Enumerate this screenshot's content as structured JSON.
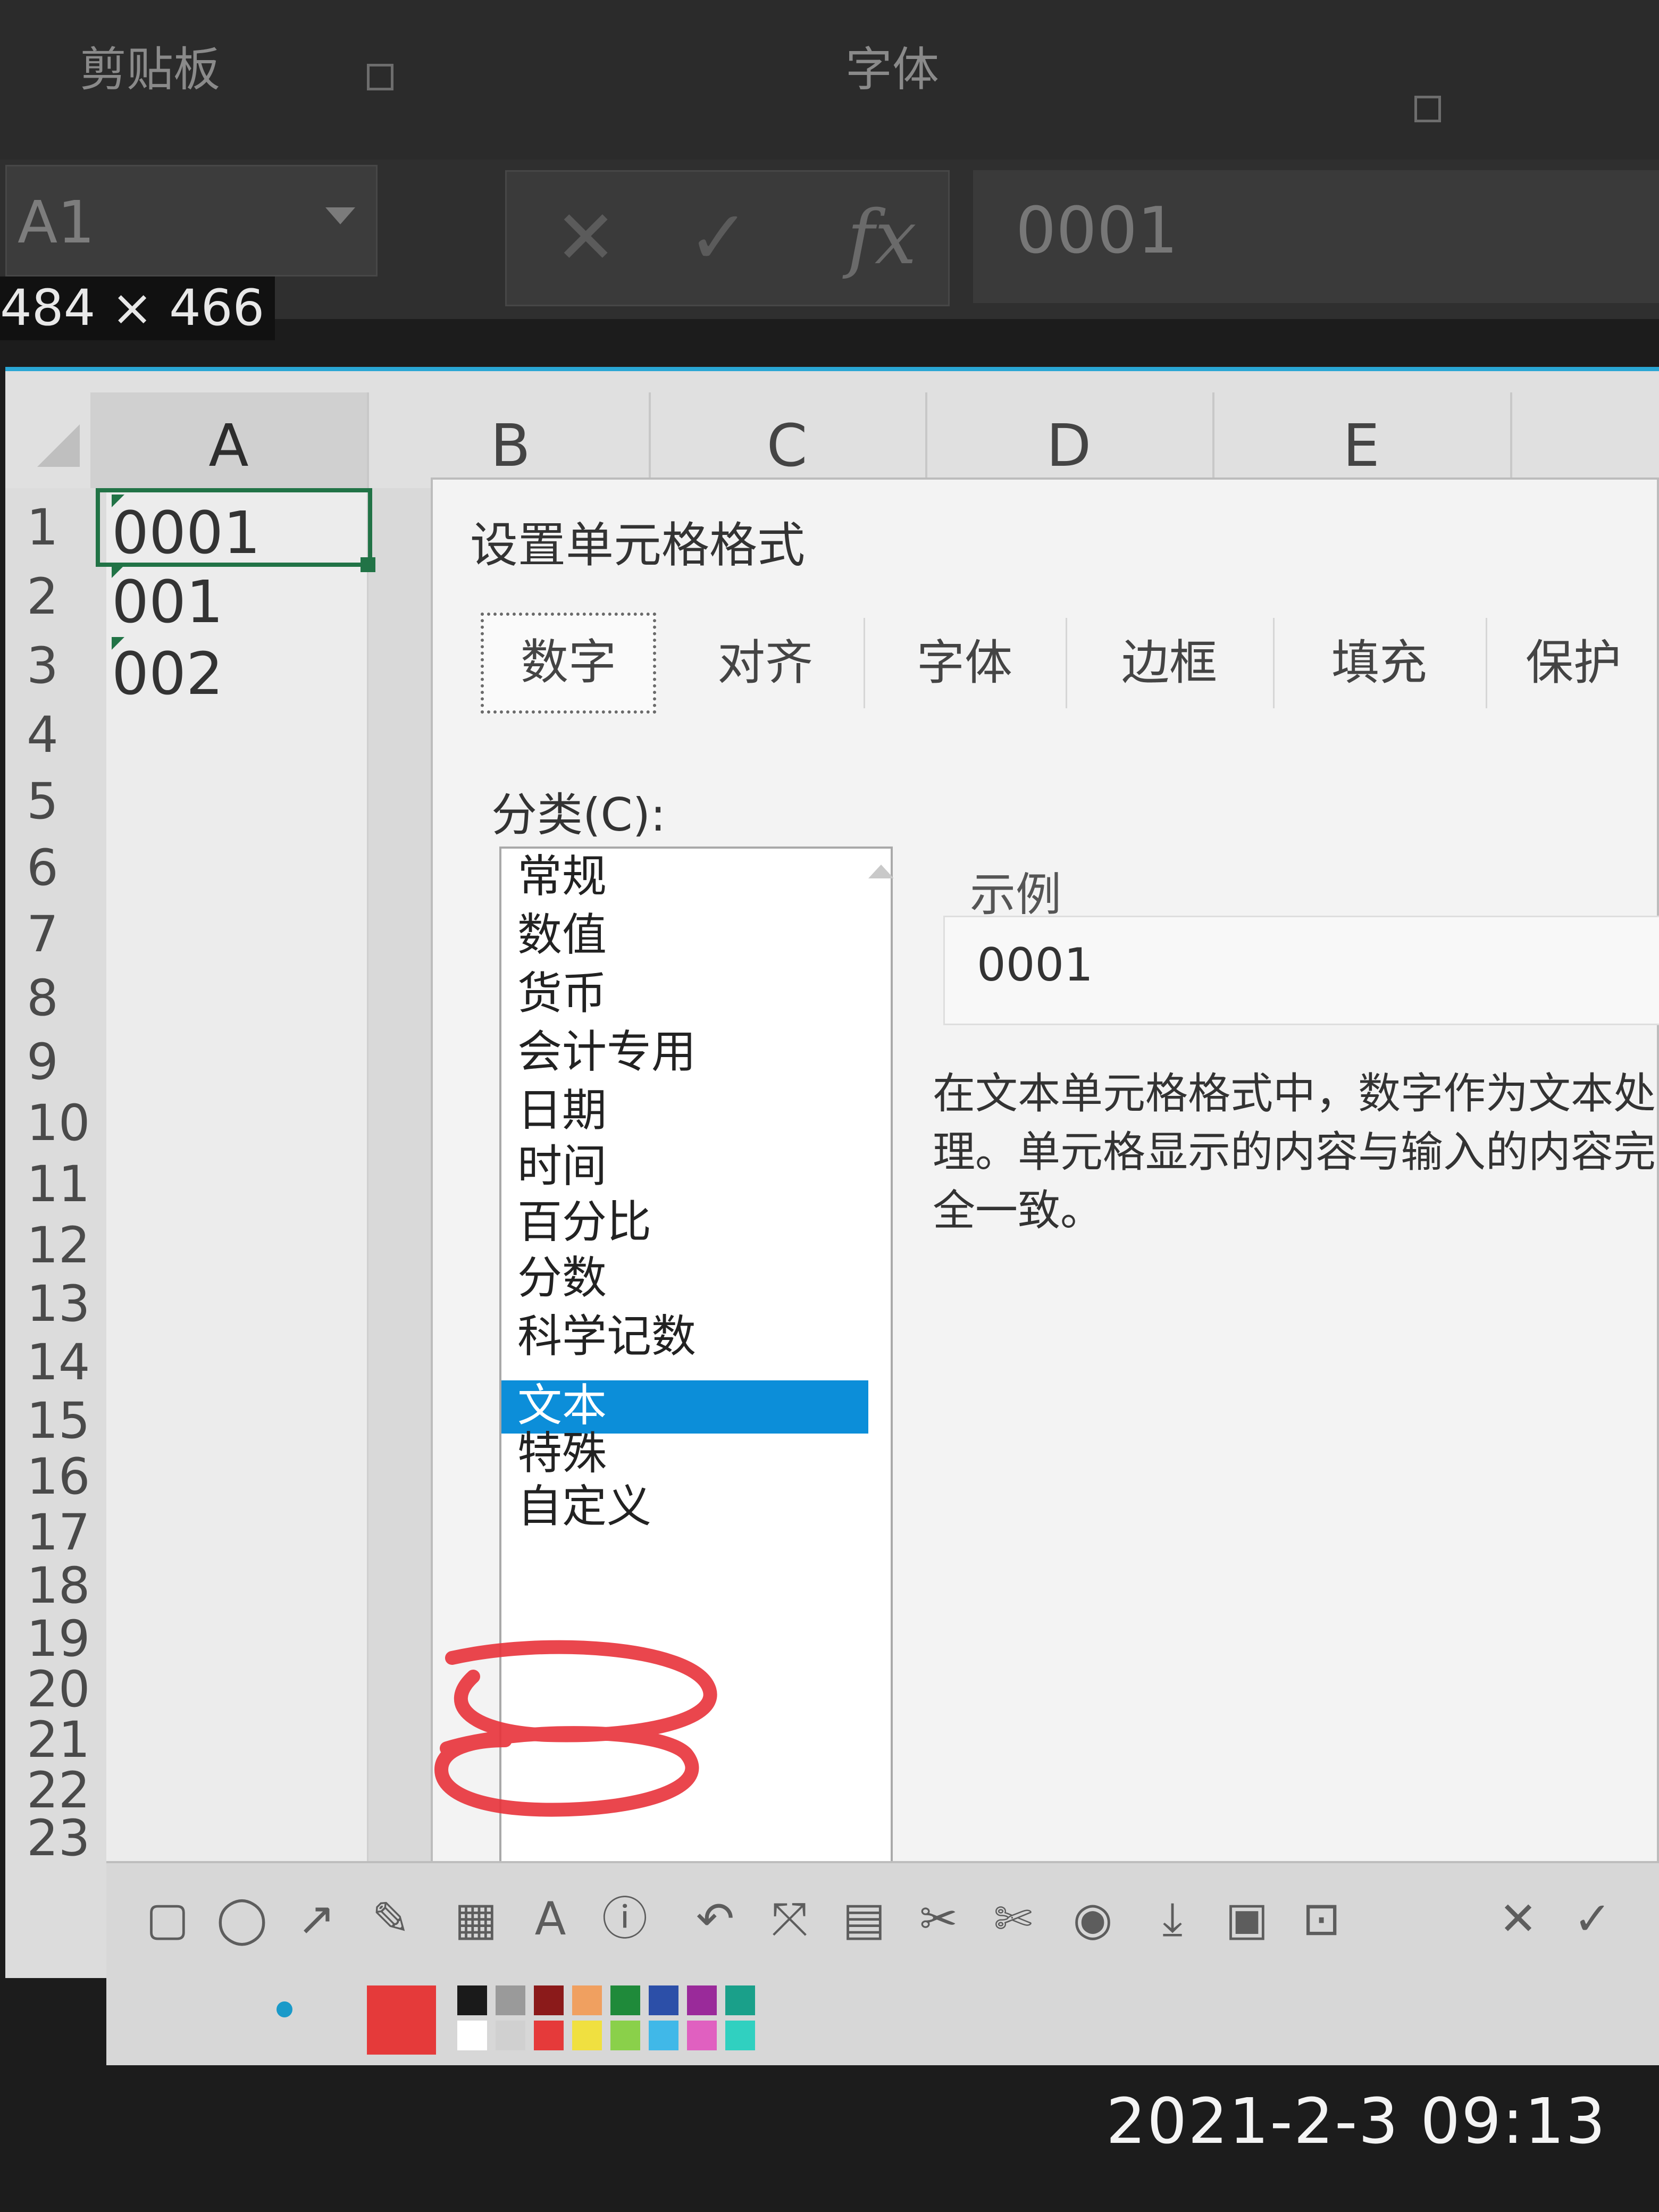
{
  "ribbon": {
    "clipboard_label": "剪贴板",
    "font_label": "字体"
  },
  "formula_bar": {
    "name_box": "A1",
    "cancel_icon": "✕",
    "enter_icon": "✓",
    "fx": "fx",
    "value": "0001"
  },
  "capture_size": "484 × 466",
  "sheet": {
    "columns": [
      "A",
      "B",
      "C",
      "D",
      "E"
    ],
    "rows": [
      "1",
      "2",
      "3",
      "4",
      "5",
      "6",
      "7",
      "8",
      "9",
      "10",
      "11",
      "12",
      "13",
      "14",
      "15",
      "16",
      "17",
      "18",
      "19",
      "20",
      "21",
      "22",
      "23"
    ],
    "cells": [
      "0001",
      "001",
      "002"
    ]
  },
  "dialog": {
    "title": "设置单元格格式",
    "tabs": [
      "数字",
      "对齐",
      "字体",
      "边框",
      "填充",
      "保护"
    ],
    "category_label": "分类(C):",
    "categories": [
      "常规",
      "数值",
      "货币",
      "会计专用",
      "日期",
      "时间",
      "百分比",
      "分数",
      "科学记数",
      "文本",
      "特殊",
      "自定义"
    ],
    "selected_category": "文本",
    "sample_label": "示例",
    "sample_value": "0001",
    "description": "在文本单元格格式中，数字作为文本处理。单元格显示的内容与输入的内容完全一致。"
  },
  "annotation_color": "#e8323a",
  "toolbar": {
    "tools": [
      "▢",
      "◯",
      "↗",
      "✎",
      "▦",
      "A",
      "ⓘ",
      "↶",
      "⤧",
      "▤",
      "✂",
      "✄",
      "◉",
      "⤓",
      "▣",
      "⊡",
      "✕",
      "✓"
    ],
    "current_color": "#e53a3a",
    "palette_top": [
      "#1a1a1a",
      "#9a9a9a",
      "#8b1a1a",
      "#f0a060",
      "#1f8a3a",
      "#2c4fa8",
      "#9a2a9a",
      "#1aa08a"
    ],
    "palette_bottom": [
      "#ffffff",
      "#d0d0d0",
      "#e53a3a",
      "#f0e040",
      "#8ad04a",
      "#40b8e8",
      "#e060c0",
      "#30d0c0"
    ]
  },
  "timestamp": "2021-2-3 09:13"
}
